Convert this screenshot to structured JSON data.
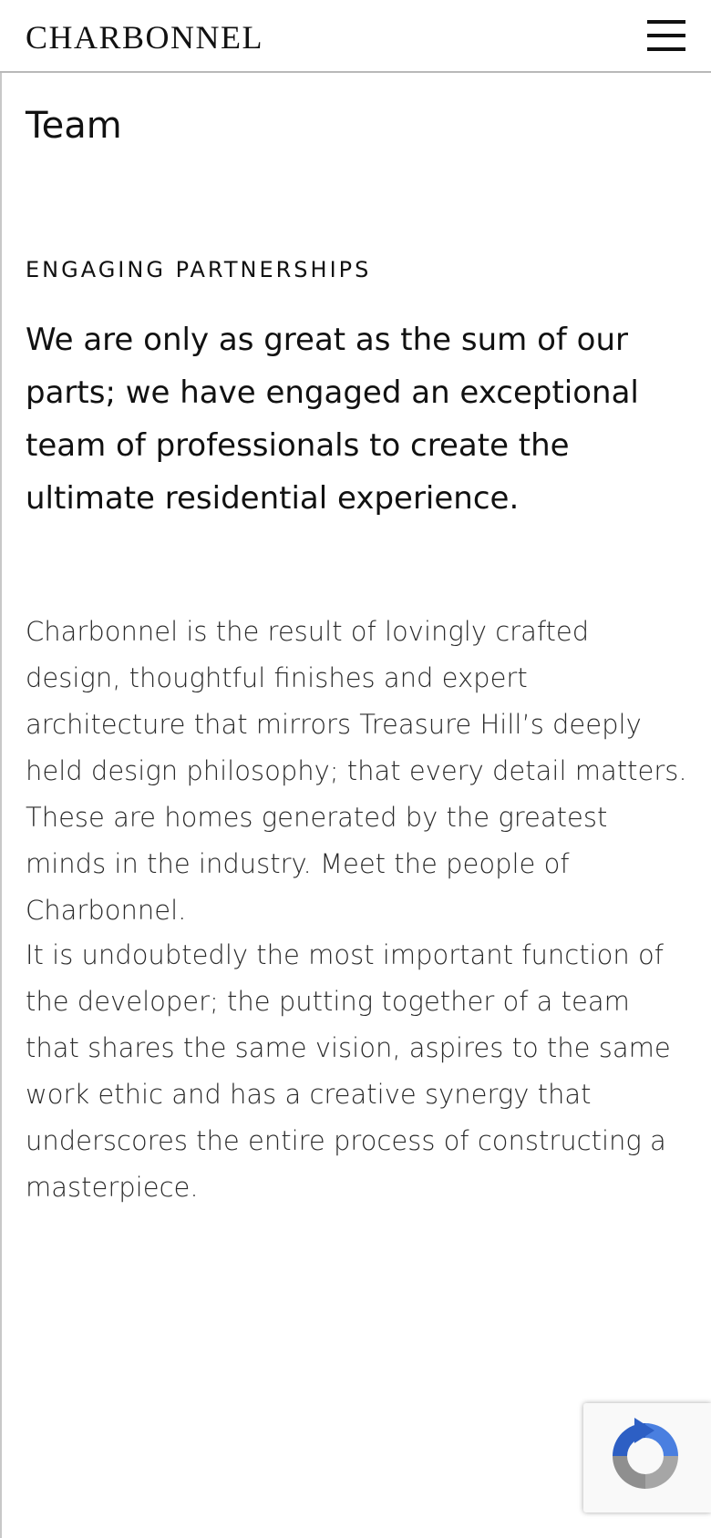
{
  "header": {
    "logo": "CHARBONNEL",
    "menu_icon": "hamburger-menu-icon"
  },
  "main": {
    "title": "Team",
    "eyebrow": "ENGAGING PARTNERSHIPS",
    "lead": "We are only as great as the sum of our parts; we have engaged an exceptional team of professionals to create the ultimate residential experience.",
    "paragraphs": [
      "Charbonnel is the result of lovingly crafted design, thoughtful finishes and expert architecture that mirrors Treasure Hill’s deeply held design philosophy; that every detail matters. These are homes generated by the greatest minds in the industry. Meet the people of Charbonnel.",
      "It is undoubtedly the most important function of the developer; the putting together of a team that shares the same vision, aspires to the same work ethic and has a creative synergy that underscores the entire process of constructing a masterpiece."
    ]
  },
  "recaptcha": {
    "icon": "recaptcha-logo-icon"
  },
  "colors": {
    "text": "#111111",
    "body_text": "#2a2a2a",
    "background": "#ffffff",
    "divider": "#b9b9b9",
    "recaptcha_blue": "#4a7fe0",
    "recaptcha_grey": "#a6a6a6"
  }
}
